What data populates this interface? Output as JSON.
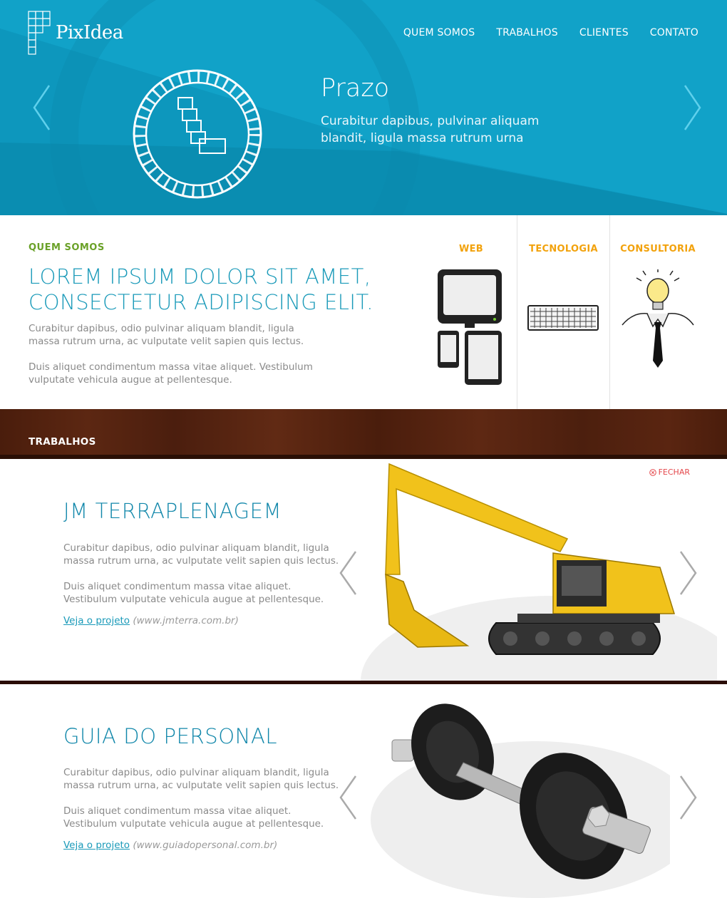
{
  "header": {
    "logo_text": "PixIdea",
    "nav": [
      "QUEM SOMOS",
      "TRABALHOS",
      "CLIENTES",
      "CONTATO"
    ]
  },
  "hero": {
    "title": "Prazo",
    "text": "Curabitur dapibus, pulvinar aliquam blandit, ligula massa rutrum urna",
    "icons": [
      "chevron-left-icon",
      "clock-icon",
      "chevron-right-icon"
    ]
  },
  "about": {
    "label": "QUEM SOMOS",
    "title": "LOREM IPSUM DOLOR SIT AMET, CONSECTETUR ADIPISCING ELIT.",
    "p1": "Curabitur dapibus, odio pulvinar aliquam blandit, ligula massa rutrum urna, ac vulputate velit sapien quis lectus.",
    "p2": "Duis aliquet condimentum massa vitae aliquet. Vestibulum vulputate vehicula augue at pellentesque.",
    "services": [
      {
        "label": "WEB",
        "icon": "devices-icon"
      },
      {
        "label": "TECNOLOGIA",
        "icon": "keyboard-icon"
      },
      {
        "label": "CONSULTORIA",
        "icon": "lightbulb-tie-icon"
      }
    ]
  },
  "works": {
    "label": "TRABALHOS",
    "close_label": "FECHAR",
    "items": [
      {
        "title": "JM TERRAPLENAGEM",
        "p1": "Curabitur dapibus, odio pulvinar aliquam blandit, ligula massa rutrum urna, ac vulputate velit sapien quis lectus.",
        "p2": "Duis aliquet condimentum massa vitae aliquet. Vestibulum vulputate vehicula augue at pellentesque.",
        "link": "Veja o projeto",
        "url": "(www.jmterra.com.br)",
        "image": "excavator-image"
      },
      {
        "title": "GUIA DO PERSONAL",
        "p1": "Curabitur dapibus, odio pulvinar aliquam blandit, ligula massa rutrum urna, ac vulputate velit sapien quis lectus.",
        "p2": "Duis aliquet condimentum massa vitae aliquet. Vestibulum vulputate vehicula augue at pellentesque.",
        "link": "Veja o projeto",
        "url": "(www.guiadopersonal.com.br)",
        "image": "dumbbell-image"
      }
    ]
  },
  "colors": {
    "hero_bg": "#0d97bd",
    "accent_blue": "#1a9ab9",
    "green": "#6aa128",
    "orange": "#f2a20c",
    "wood": "#4a1d0c",
    "close_red": "#e4474b"
  }
}
